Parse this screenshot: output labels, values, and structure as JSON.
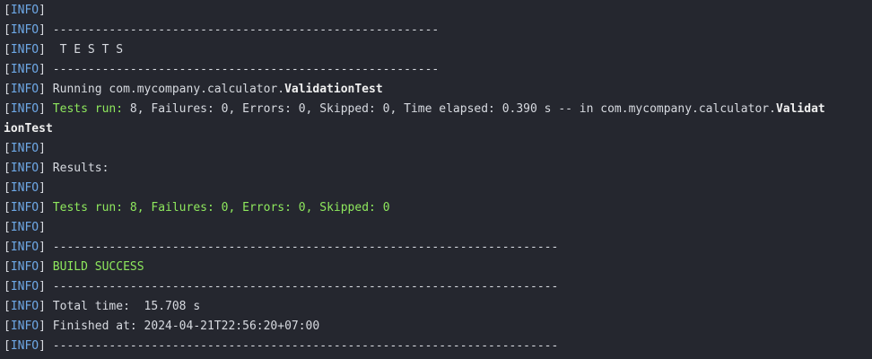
{
  "colors": {
    "background": "#25272f",
    "text": "#d7dae0",
    "info_tag": "#6ea8e6",
    "success": "#8ee85d"
  },
  "tag": "INFO",
  "lines": [
    {
      "segments": []
    },
    {
      "segments": [
        {
          "text": "-------------------------------------------------------",
          "style": "plain"
        }
      ]
    },
    {
      "segments": [
        {
          "text": " T E S T S",
          "style": "plain"
        }
      ]
    },
    {
      "segments": [
        {
          "text": "-------------------------------------------------------",
          "style": "plain"
        }
      ]
    },
    {
      "segments": [
        {
          "text": "Running com.mycompany.calculator.",
          "style": "plain"
        },
        {
          "text": "ValidationTest",
          "style": "bold"
        }
      ]
    },
    {
      "segments": [
        {
          "text": "Tests run: ",
          "style": "green"
        },
        {
          "text": "8, Failures: 0, Errors: 0, Skipped: 0, Time elapsed: 0.390 s -- in com.mycompany.calculator.",
          "style": "plain"
        },
        {
          "text": "Validat",
          "style": "bold"
        }
      ]
    },
    {
      "no_tag": true,
      "segments": [
        {
          "text": "ionTest",
          "style": "bold"
        }
      ]
    },
    {
      "segments": []
    },
    {
      "segments": [
        {
          "text": "Results:",
          "style": "plain"
        }
      ]
    },
    {
      "segments": []
    },
    {
      "segments": [
        {
          "text": "Tests run: ",
          "style": "green"
        },
        {
          "text": "8, ",
          "style": "green"
        },
        {
          "text": "Failures: ",
          "style": "green"
        },
        {
          "text": "0, ",
          "style": "green"
        },
        {
          "text": "Errors: ",
          "style": "green"
        },
        {
          "text": "0, ",
          "style": "green"
        },
        {
          "text": "Skipped: ",
          "style": "green"
        },
        {
          "text": "0",
          "style": "green"
        }
      ]
    },
    {
      "segments": []
    },
    {
      "segments": [
        {
          "text": "------------------------------------------------------------------------",
          "style": "plain"
        }
      ]
    },
    {
      "segments": [
        {
          "text": "BUILD SUCCESS",
          "style": "green"
        }
      ]
    },
    {
      "segments": [
        {
          "text": "------------------------------------------------------------------------",
          "style": "plain"
        }
      ]
    },
    {
      "segments": [
        {
          "text": "Total time:  15.708 s",
          "style": "plain"
        }
      ]
    },
    {
      "segments": [
        {
          "text": "Finished at: 2024-04-21T22:56:20+07:00",
          "style": "plain"
        }
      ]
    },
    {
      "segments": [
        {
          "text": "------------------------------------------------------------------------",
          "style": "plain"
        }
      ]
    },
    {
      "segments": []
    }
  ]
}
